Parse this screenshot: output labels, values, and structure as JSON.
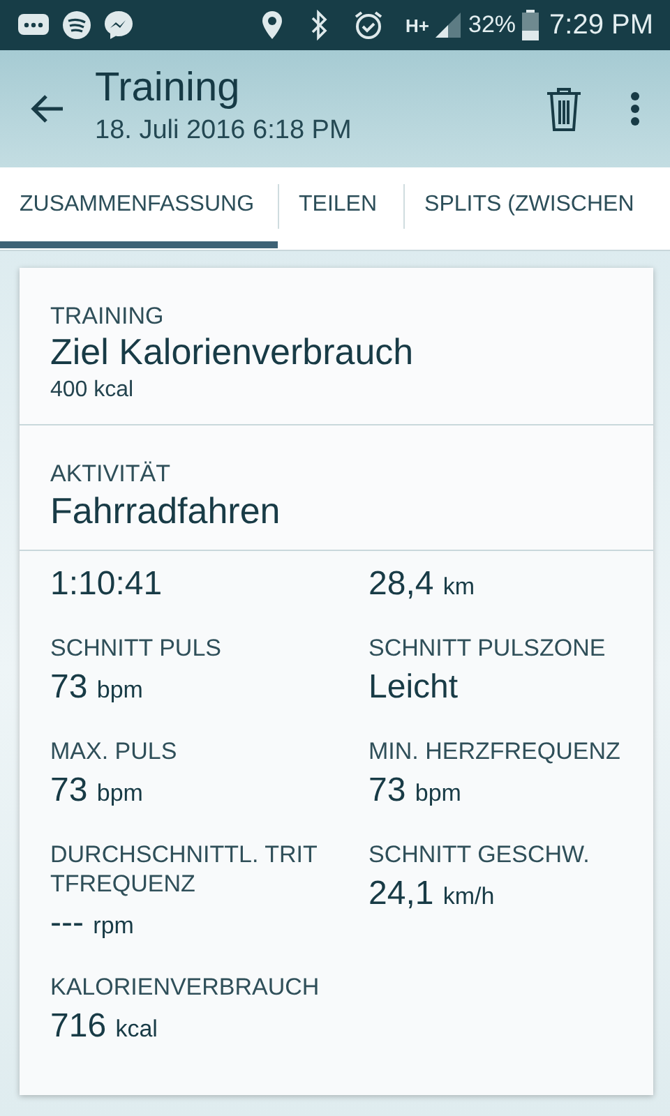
{
  "status_bar": {
    "network": "H+",
    "battery": "32%",
    "time": "7:29 PM"
  },
  "app_bar": {
    "title": "Training",
    "subtitle": "18. Juli 2016 6:18 PM"
  },
  "tabs": [
    {
      "label": "ZUSAMMENFASSUNG",
      "selected": true
    },
    {
      "label": "TEILEN",
      "selected": false
    },
    {
      "label": "SPLITS (ZWISCHEN",
      "selected": false
    }
  ],
  "summary": [
    {
      "label": "TRAINING",
      "value": "Ziel Kalorienverbrauch",
      "detail": "400 kcal"
    },
    {
      "label": "AKTIVITÄT",
      "value": "Fahrradfahren"
    }
  ],
  "stats": [
    {
      "value": "1:10:41"
    },
    {
      "value": "28,4",
      "unit": "km"
    },
    {
      "label": "SCHNITT PULS",
      "value": "73",
      "unit": "bpm"
    },
    {
      "label": "SCHNITT PULSZONE",
      "value": "Leicht"
    },
    {
      "label": "MAX. PULS",
      "value": "73",
      "unit": "bpm"
    },
    {
      "label": "MIN. HERZFREQUENZ",
      "value": "73",
      "unit": "bpm"
    },
    {
      "label": "DURCHSCHNITTL. TRITTFREQUENZ",
      "value": "---",
      "unit": "rpm"
    },
    {
      "label": "SCHNITT GESCHW.",
      "value": "24,1",
      "unit": "km/h"
    },
    {
      "label": "KALORIENVERBRAUCH",
      "value": "716",
      "unit": "kcal"
    }
  ]
}
